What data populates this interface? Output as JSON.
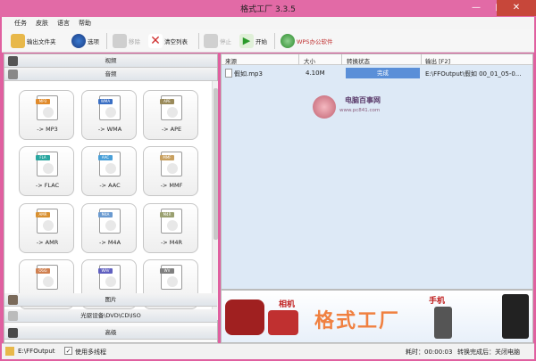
{
  "window": {
    "title": "格式工厂 3.3.5",
    "controls": {
      "minimize": "—",
      "maximize": "□",
      "close": "✕"
    }
  },
  "menu": [
    "任务",
    "皮肤",
    "语言",
    "帮助"
  ],
  "toolbar": {
    "output_folder": "输出文件夹",
    "options": "选项",
    "remove": "移除",
    "clear_list": "清空列表",
    "stop": "停止",
    "start": "开始",
    "wps": "WPS办公软件"
  },
  "categories": {
    "video": "视频",
    "audio": "音频",
    "picture": "图片",
    "rom": "光驱设备\\DVD\\CD\\ISO",
    "advanced": "高级"
  },
  "formats": [
    {
      "tag": "MP3",
      "label": "-> MP3",
      "color": "#e08a2a",
      "icon": "speaker-icon"
    },
    {
      "tag": "WMA",
      "label": "-> WMA",
      "color": "#3a6fc4",
      "icon": "play-icon"
    },
    {
      "tag": "APE",
      "label": "-> APE",
      "color": "#9a8a5a",
      "icon": "speaker-icon"
    },
    {
      "tag": "FLA",
      "label": "-> FLAC",
      "color": "#2aa6a0",
      "icon": "headphones-icon"
    },
    {
      "tag": "AAC",
      "label": "-> AAC",
      "color": "#4aa0d8",
      "icon": "ipod-icon"
    },
    {
      "tag": "MMF",
      "label": "-> MMF",
      "color": "#c8a060",
      "icon": "phone-icon"
    },
    {
      "tag": "AMR",
      "label": "-> AMR",
      "color": "#d89030",
      "icon": "phone-icon"
    },
    {
      "tag": "M4A",
      "label": "-> M4A",
      "color": "#6a9ad0",
      "icon": "ipod-icon"
    },
    {
      "tag": "M4R",
      "label": "-> M4R",
      "color": "#9aa070",
      "icon": "phone-icon"
    },
    {
      "tag": "OGG",
      "label": "",
      "color": "#d08050",
      "icon": "ogg-icon"
    },
    {
      "tag": "WAV",
      "label": "",
      "color": "#6060c0",
      "icon": "wave-icon"
    },
    {
      "tag": "WV",
      "label": "",
      "color": "#808080",
      "icon": "wave-icon"
    }
  ],
  "table": {
    "headers": [
      "来源",
      "大小",
      "转换状态",
      "输出 [F2]"
    ],
    "rows": [
      {
        "source": "假如.mp3",
        "size": "4.10M",
        "status": "完成",
        "output": "E:\\FFOutput\\假如 00_01_05-0..."
      }
    ]
  },
  "watermark": {
    "line1": "电脑百事网",
    "line2": "www.pc841.com"
  },
  "banner": {
    "camera_label": "相机",
    "brand": "格式工厂",
    "phone_label": "手机"
  },
  "status": {
    "output_path": "E:\\FFOutput",
    "multithread_label": "使用多线程",
    "multithread_checked": true,
    "elapsed_label": "耗时：00:00:03",
    "after_convert_label": "转换完成后：关闭电脑"
  },
  "colors": {
    "accent": "#e060a0",
    "progress": "#5a8fd8"
  }
}
